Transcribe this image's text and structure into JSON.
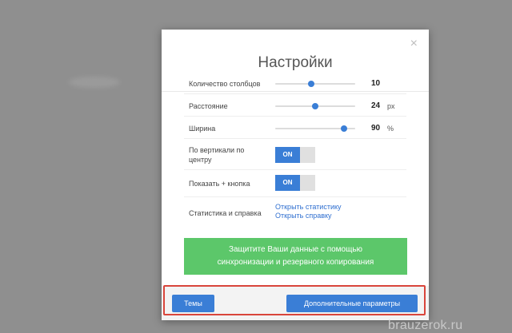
{
  "dialog": {
    "title": "Настройки",
    "close_symbol": "×"
  },
  "settings": {
    "columns": {
      "label": "Количество столбцов",
      "value": "10",
      "level": 0.45
    },
    "distance": {
      "label": "Расстояние",
      "value": "24",
      "unit": "px",
      "level": 0.5
    },
    "width": {
      "label": "Ширина",
      "value": "90",
      "unit": "%",
      "level": 0.86
    },
    "vertical_center": {
      "label_line1": "По вертикали по",
      "label_line2": "центру",
      "toggle": "ON"
    },
    "show_plus": {
      "label": "Показать + кнопка",
      "toggle": "ON"
    },
    "stats": {
      "label": "Статистика и справка",
      "link1": "Открыть статистику",
      "link2": "Открыть справку"
    }
  },
  "sync_banner": {
    "line1": "Защитите Ваши данные с помощью",
    "line2": "синхронизации и резервного копирования"
  },
  "footer": {
    "themes_label": "Темы",
    "advanced_label": "Дополнительные параметры"
  },
  "watermark": "brauzerok.ru",
  "colors": {
    "accent": "#3a7ed6",
    "green": "#5cc76a",
    "highlight": "#d9453b"
  }
}
